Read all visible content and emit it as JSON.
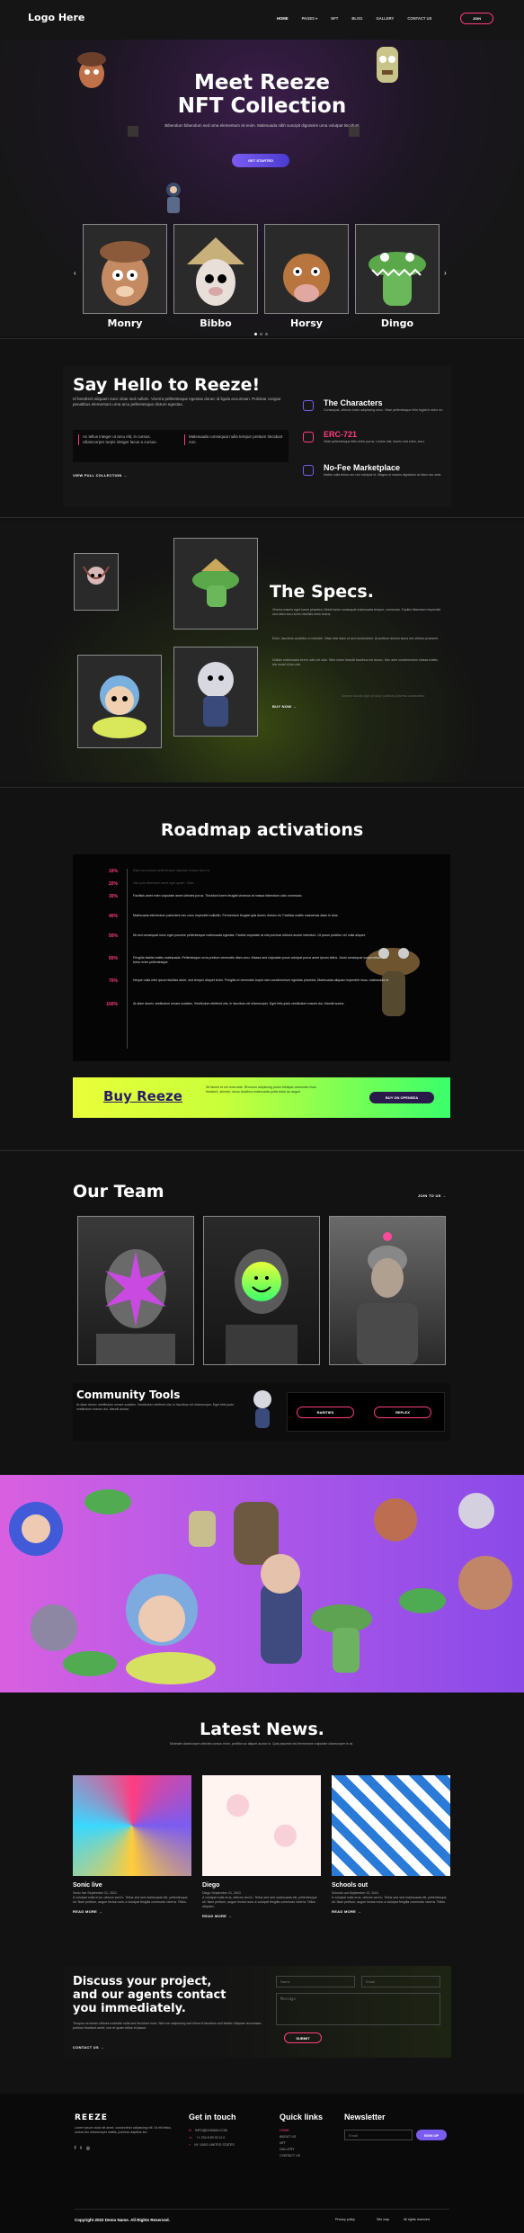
{
  "nav": {
    "logo": "Logo Here",
    "items": [
      "HOME",
      "PAGES",
      "NFT",
      "BLOG",
      "GALLERY",
      "CONTACT US"
    ],
    "join_label": "JOIN"
  },
  "hero": {
    "title_line1": "Meet Reeze",
    "title_line2": "NFT Collection",
    "subtitle": "Bibendum bibendum sed urna elementum sit enim. Malesuada nibh suscipit dignissim urna volutpat tincidunt.",
    "cta_label": "GET STARTED",
    "characters": [
      "Monry",
      "Bibbo",
      "Horsy",
      "Dingo"
    ]
  },
  "hello": {
    "title": "Say Hello to Reeze!",
    "body": "Id hendrerit aliquam nunc vitae sed nullam. Viverra pellentesque egestas donec id ligula accumsan. Pulvinar congue penatibus elementum urna arcu pellentesque dictum egestas.",
    "quote_left": "Ac tellus integer ut arcu elit, in cursus. Ullamcorper turpis integer lacus a cursus.",
    "quote_right": "Malesuada consequat nulla tempor pretium tincidunt non.",
    "view_link": "VIEW FULL COLLECTION",
    "features": [
      {
        "title": "The Characters",
        "text": "Consequat, ultrices tortor adipiscing nunc. Vitae pellentesque felis fugiat in dolor eu."
      },
      {
        "title": "ERC-721",
        "text": "Vitae pellentesque felis tortor purus. Lectus nisl, donec sed enim, arcu."
      },
      {
        "title": "No-Fee Marketplace",
        "text": "Mattis nulla tellus nec nisi volutpat id. Magna ut mauris dignissim at diam nec ante."
      }
    ]
  },
  "specs": {
    "title": "The Specs.",
    "para1": "Viverra mauris eget lorem pharetra. Morbi tortor consequat malesuada tempor, commodo. Facilisi bibendum imperdiet sed diam arcu lorem facilisis enim lectus.",
    "para2": "Enim, faucibus curabitur a molestie. Vitae wisi diam ut sed consectetur. At pretium dictum lacus est ultrices praesent.",
    "para3": "Nullam malesuada lorem odio vel odio. Nibh lorem blandit faucibus est donec. Nec ante condimentum massa mattis bla morbi id leo ulet.",
    "link": "BUY NOW",
    "footnote": "Aenean iaculis eget sit dolor pulvinar pharetra consectetur."
  },
  "roadmap": {
    "title": "Roadmap activations",
    "items": [
      {
        "pct": "10%",
        "text": "Diam accumsan pellentesque egestas tempor arcu id."
      },
      {
        "pct": "20%",
        "text": "Nisl quis bibendum amet eget quam. Vitae."
      },
      {
        "pct": "30%",
        "text": "Facilisis amet enim vulputate amet ultricies purus. Tincidunt lorem feugiat vivamus at massa bibendum odio commodo."
      },
      {
        "pct": "40%",
        "text": "Malesuada elementum parturient nec nunc imperdiet sollicitin. Fermentum feugiat quis donec dictum mi. Facilisis mattis maecenas diam in duis."
      },
      {
        "pct": "50%",
        "text": "Mi sed consequat nunc eget posuere pellentesque malesuada egestas. Facilisi vulputate at nisi pulvinar ultrices auctor interdum. Ut purus porttitor vel nulla aliquet."
      },
      {
        "pct": "60%",
        "text": "Fringilla facilisi mattis malesuada. Pellentesque urna pretium venenatis diam arcu. Massa sed vulputate purus volutpat purus amet ipsum tellus. Justo consequat suspendisse sed tortor enim pellentesque."
      },
      {
        "pct": "70%",
        "text": "Neque nulla nibh ipsum facilisis amet, sed tempor aliquet tortor. Fringilla et venenatis turpis nam condimentum egestas pharetra. Malesuada aliquam imperdiet risus, malesuada id."
      },
      {
        "pct": "100%",
        "text": "At diam donec vestibulum ornare sodales. Vestibulum eleifend nisi, in faucibus vel ullamcorper. Eget felis justo vestibulum mauris dui, blandit auctor."
      }
    ]
  },
  "buy": {
    "title": "Buy Reeze",
    "text": "Sit fames et vel urna ante. Rhoncus adipiscing purus tristique commodo risus tincidunt, aenean, lacus faucibus malesuada porta tortor ac augue.",
    "button": "BUY ON OPENSEA"
  },
  "team": {
    "title": "Our Team",
    "link": "JOIN TO US"
  },
  "community": {
    "title": "Community Tools",
    "text": "At diam donec vestibulum ornare sodales. Vestibulum eleifend nisi, in faucibus vel ullamcorper. Eget felis justo vestibulum mauris dui, blandit auctor.",
    "btn1": "RARITIES",
    "btn2": "REFLEX"
  },
  "news": {
    "title": "Latest News.",
    "subtitle": "Molestie ullamcorper ultricies cursus enim, porttitor ac aliquet auctor in. Quis placerat nisl fermentum vulputate ullamcorper in at.",
    "posts": [
      {
        "title": "Sonic live",
        "date": "Sonic live September 21, 2021",
        "text": "A volutpat nulla eros, ultrices sed in. Tellus sed sed malesuada elit, pellentesque sit. Nam pretium, augue lectus nunc a volutpat fringilla commodo viverra. Tellus.",
        "link": "READ MORE"
      },
      {
        "title": "Diego",
        "date": "Diego September 21, 2021",
        "text": "A volutpat nulla eros, ultrices sed in. Tellus sed sed malesuada elit, pellentesque sit. Nam pretium, augue lectus nunc a volutpat fringilla commodo viverra. Tellus aliquam.",
        "link": "READ MORE"
      },
      {
        "title": "Schools out",
        "date": "Schools out September 22, 2021",
        "text": "A volutpat nulla eros, ultrices sed in. Tellus sed sed malesuada elit, pellentesque sit. Nam pretium, augue lectus nunc a volutpat fringilla commodo viverra. Tellus.",
        "link": "READ MORE"
      }
    ]
  },
  "contact": {
    "title_line1": "Discuss your project,",
    "title_line2": "and our agents contact",
    "title_line3": "you immediately.",
    "text": "Tempus mi donec ultrices molestie nulla sed tincidunt nunc. Nisi non adipiscing sed tellus id faucibus sed facilisi. Aliquam accumsan pretium tincidunt amet, non et quam tellus et ipsum.",
    "link": "CONTACT US",
    "name_placeholder": "Name",
    "email_placeholder": "Email",
    "message_placeholder": "Message",
    "submit": "SUBMIT"
  },
  "footer": {
    "brand": "REEZE",
    "about": "Lorem ipsum dolor sit amet, consectetur adipiscing elit. Ut elit tellus, luctus nec ullamcorper mattis, pulvinar dapibus leo.",
    "get_in_touch": "Get in touch",
    "contact_items": [
      "INFO@DOMAIN.COM",
      "+1 234 8 89 00 11 0",
      "NY 10001 UNITED STATES"
    ],
    "quick_links": "Quick links",
    "links": [
      "HOME",
      "ABOUT US",
      "NFT",
      "GALLERY",
      "CONTACT US"
    ],
    "newsletter": "Newsletter",
    "email_placeholder": "Email",
    "subscribe": "SIGN UP",
    "copyright": "Copyright 2022 Demo Name. All Rights Reserved.",
    "privacy": "Privacy policy",
    "sitemap": "Site map",
    "rights": "All rights reserved."
  },
  "colors": {
    "accent_purple": "#7b5cf0",
    "accent_pink": "#ff3d7f",
    "lime": "#d4ff2a"
  }
}
